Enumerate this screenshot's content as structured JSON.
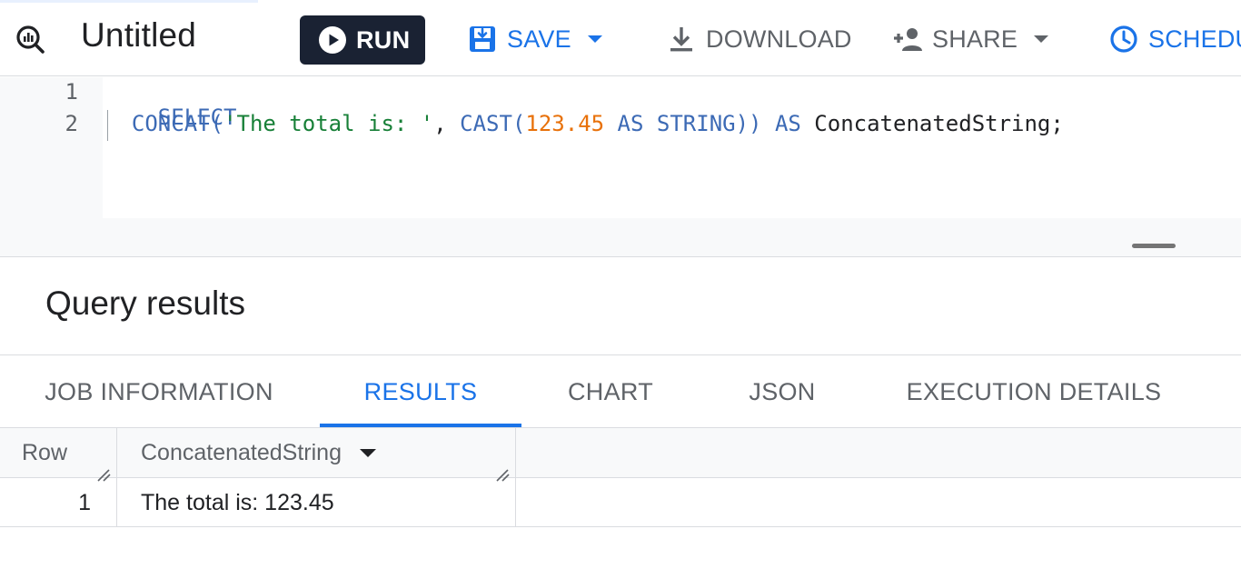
{
  "toolbar": {
    "title": "Untitled",
    "run_label": "RUN",
    "save_label": "SAVE",
    "download_label": "DOWNLOAD",
    "share_label": "SHARE",
    "schedule_label": "SCHEDU",
    "colors": {
      "run_bg": "#1a2233",
      "accent": "#1a73e8",
      "muted": "#5f6368"
    }
  },
  "editor": {
    "lines": [
      {
        "number": "1",
        "tokens": [
          {
            "text": "SELECT",
            "kind": "kw"
          }
        ]
      },
      {
        "number": "2",
        "tokens": [
          {
            "text": "CONCAT(",
            "kind": "kw"
          },
          {
            "text": "'The total is: '",
            "kind": "str"
          },
          {
            "text": ", ",
            "kind": "ident"
          },
          {
            "text": "CAST(",
            "kind": "kw"
          },
          {
            "text": "123.45",
            "kind": "num"
          },
          {
            "text": " AS STRING)) AS ",
            "kind": "kw"
          },
          {
            "text": "ConcatenatedString;",
            "kind": "ident"
          }
        ]
      }
    ]
  },
  "results": {
    "title": "Query results",
    "tabs": [
      {
        "label": "JOB INFORMATION",
        "active": false
      },
      {
        "label": "RESULTS",
        "active": true
      },
      {
        "label": "CHART",
        "active": false
      },
      {
        "label": "JSON",
        "active": false
      },
      {
        "label": "EXECUTION DETAILS",
        "active": false
      }
    ],
    "columns": {
      "row": "Row",
      "col1": "ConcatenatedString"
    },
    "rows": [
      {
        "row": "1",
        "value": "The total is: 123.45"
      }
    ]
  }
}
